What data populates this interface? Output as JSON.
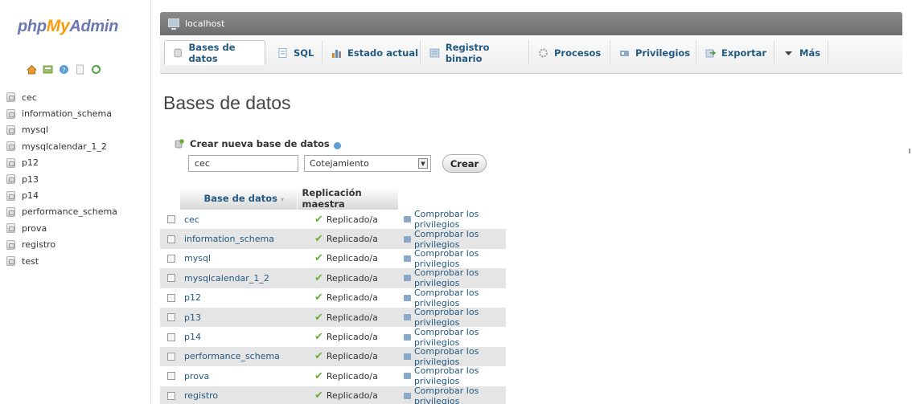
{
  "logo": {
    "php": "php",
    "my": "My",
    "admin": "Admin"
  },
  "sidebar": {
    "nav_icons": [
      "home-icon",
      "recent-icon",
      "help-icon",
      "docs-icon",
      "reload-icon"
    ],
    "databases": [
      "cec",
      "information_schema",
      "mysql",
      "mysqlcalendar_1_2",
      "p12",
      "p13",
      "p14",
      "performance_schema",
      "prova",
      "registro",
      "test"
    ]
  },
  "header": {
    "server": "localhost"
  },
  "tabs": [
    {
      "label": "Bases de datos",
      "icon": "database-icon"
    },
    {
      "label": "SQL",
      "icon": "sql-icon"
    },
    {
      "label": "Estado actual",
      "icon": "status-icon"
    },
    {
      "label": "Registro binario",
      "icon": "binlog-icon"
    },
    {
      "label": "Procesos",
      "icon": "process-icon"
    },
    {
      "label": "Privilegios",
      "icon": "privileges-icon"
    },
    {
      "label": "Exportar",
      "icon": "export-icon"
    },
    {
      "label": "Más",
      "icon": "triangle-down-icon"
    }
  ],
  "main": {
    "title": "Bases de datos",
    "create": {
      "legend": "Crear nueva base de datos",
      "name_value": "cec",
      "collation": "Cotejamiento",
      "button": "Crear"
    },
    "table": {
      "headers": {
        "name": "Base de datos",
        "replication": "Replicación maestra"
      },
      "rows": [
        {
          "name": "cec",
          "replication": "Replicado/a",
          "action": "Comprobar los privilegios"
        },
        {
          "name": "information_schema",
          "replication": "Replicado/a",
          "action": "Comprobar los privilegios"
        },
        {
          "name": "mysql",
          "replication": "Replicado/a",
          "action": "Comprobar los privilegios"
        },
        {
          "name": "mysqlcalendar_1_2",
          "replication": "Replicado/a",
          "action": "Comprobar los privilegios"
        },
        {
          "name": "p12",
          "replication": "Replicado/a",
          "action": "Comprobar los privilegios"
        },
        {
          "name": "p13",
          "replication": "Replicado/a",
          "action": "Comprobar los privilegios"
        },
        {
          "name": "p14",
          "replication": "Replicado/a",
          "action": "Comprobar los privilegios"
        },
        {
          "name": "performance_schema",
          "replication": "Replicado/a",
          "action": "Comprobar los privilegios"
        },
        {
          "name": "prova",
          "replication": "Replicado/a",
          "action": "Comprobar los privilegios"
        },
        {
          "name": "registro",
          "replication": "Replicado/a",
          "action": "Comprobar los privilegios"
        }
      ]
    }
  },
  "colors": {
    "link": "#235a81",
    "logo_blue": "#6c78af",
    "logo_orange": "#f89c0e",
    "check": "#6bb03d"
  }
}
